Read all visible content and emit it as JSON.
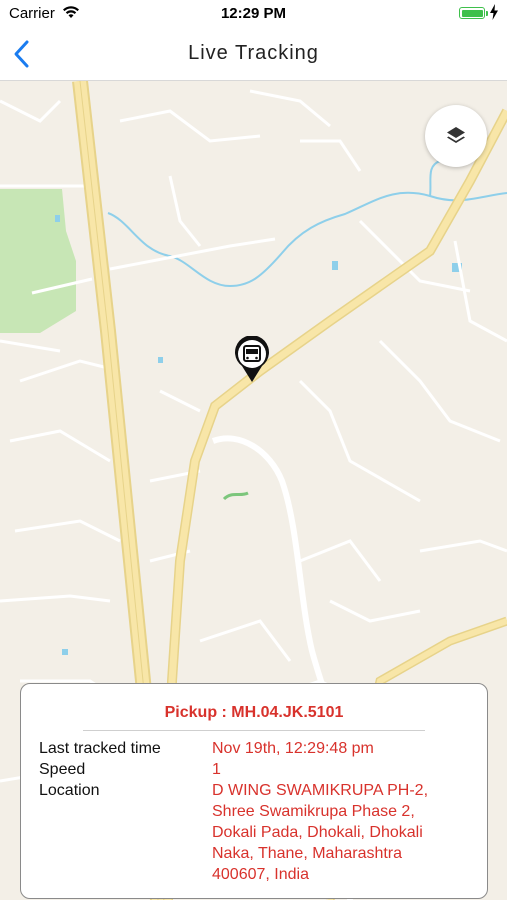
{
  "status_bar": {
    "carrier": "Carrier",
    "time": "12:29 PM",
    "battery_color": "#3ec04b"
  },
  "nav": {
    "back_icon": "chevron-left-icon",
    "title": "Live Tracking",
    "accent": "#1a7cf0"
  },
  "map": {
    "layers_icon": "layers-icon",
    "marker_icon": "bus-marker-icon",
    "colors": {
      "land": "#f3efe7",
      "road": "#ffffff",
      "highway": "#f8e6a8",
      "park": "#c7e6b5",
      "water": "#8ecfea"
    }
  },
  "info_card": {
    "title": "Pickup : MH.04.JK.5101",
    "rows": [
      {
        "label": "Last tracked time",
        "value": "Nov 19th, 12:29:48 pm"
      },
      {
        "label": "Speed",
        "value": "1"
      },
      {
        "label": "Location",
        "value": "D WING SWAMIKRUPA PH-2, Shree Swamikrupa Phase 2, Dokali Pada, Dhokali, Dhokali Naka, Thane, Maharashtra 400607, India"
      }
    ],
    "accent_color": "#d8322c"
  }
}
